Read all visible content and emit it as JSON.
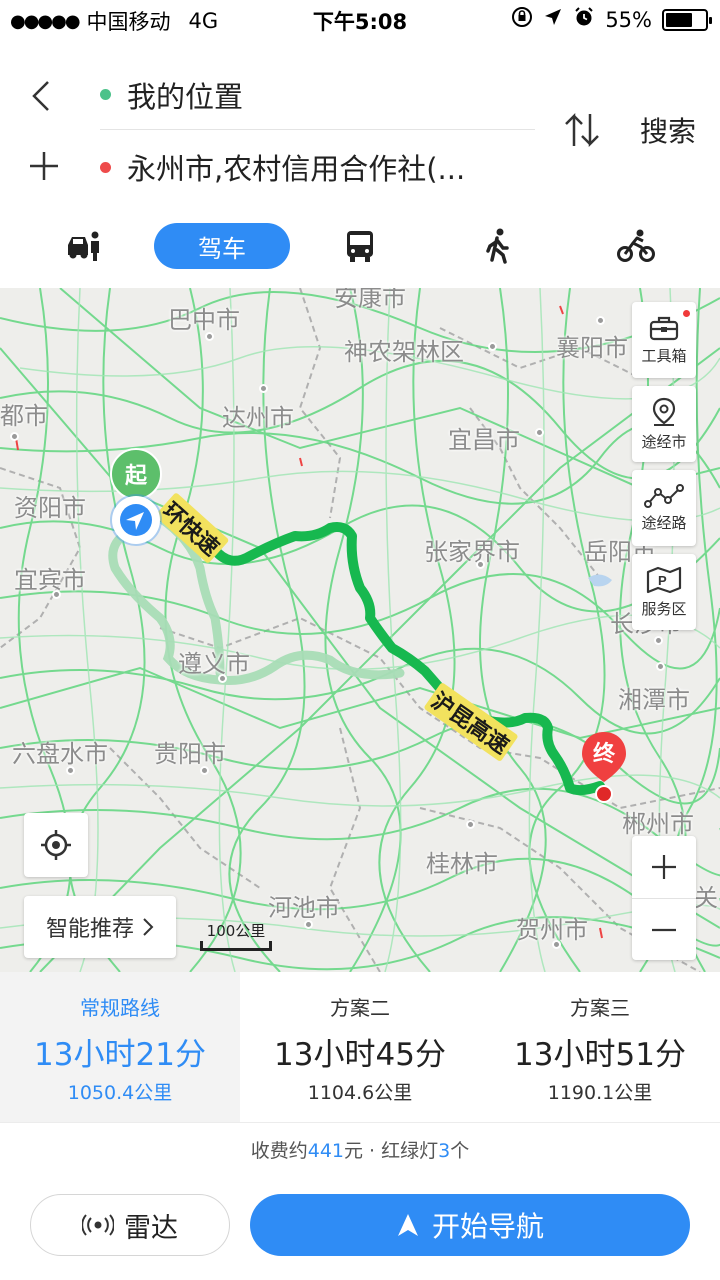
{
  "status_bar": {
    "signal": "●●●●●",
    "carrier": "中国移动",
    "network": "4G",
    "time": "下午5:08",
    "battery": "55%"
  },
  "route_header": {
    "from": "我的位置",
    "to": "永州市,农村信用合作社(...",
    "search_label": "搜索",
    "from_dot_color": "#4cc28a",
    "to_dot_color": "#ee4b4b"
  },
  "modes": {
    "active_label": "驾车",
    "items": [
      "taxi-icon",
      "car-icon",
      "bus-icon",
      "walk-icon",
      "bike-icon"
    ]
  },
  "map": {
    "cities": [
      "巴中市",
      "神农架林区",
      "襄阳市",
      "都市",
      "达州市",
      "宜昌市",
      "资阳市",
      "张家界市",
      "岳阳市",
      "宜宾市",
      "长沙市",
      "遵义市",
      "湘潭市",
      "六盘水市",
      "贵阳市",
      "郴州市",
      "桂林市",
      "河池市",
      "贺州市",
      "安康市",
      "关"
    ],
    "road_labels": [
      "环快速",
      "沪昆高速"
    ],
    "start_label": "起",
    "end_label": "终",
    "tools": [
      {
        "icon": "toolbox-icon",
        "label": "工具箱"
      },
      {
        "icon": "waypoint-city-icon",
        "label": "途经市"
      },
      {
        "icon": "waypoint-road-icon",
        "label": "途经路"
      },
      {
        "icon": "service-area-icon",
        "label": "服务区"
      }
    ],
    "smart_label": "智能推荐",
    "scale_label": "100公里",
    "route_color": "#17b84f",
    "alt_route_color": "#a8dcb6"
  },
  "route_options": [
    {
      "name": "常规路线",
      "time": "13小时21分",
      "distance": "1050.4公里"
    },
    {
      "name": "方案二",
      "time": "13小时45分",
      "distance": "1104.6公里"
    },
    {
      "name": "方案三",
      "time": "13小时51分",
      "distance": "1190.1公里"
    }
  ],
  "route_info": {
    "toll_prefix": "收费约",
    "toll_amount": "441",
    "toll_suffix": "元 · 红绿灯",
    "lights": "3",
    "lights_suffix": "个"
  },
  "bottom": {
    "radar_label": "雷达",
    "nav_label": "开始导航"
  }
}
